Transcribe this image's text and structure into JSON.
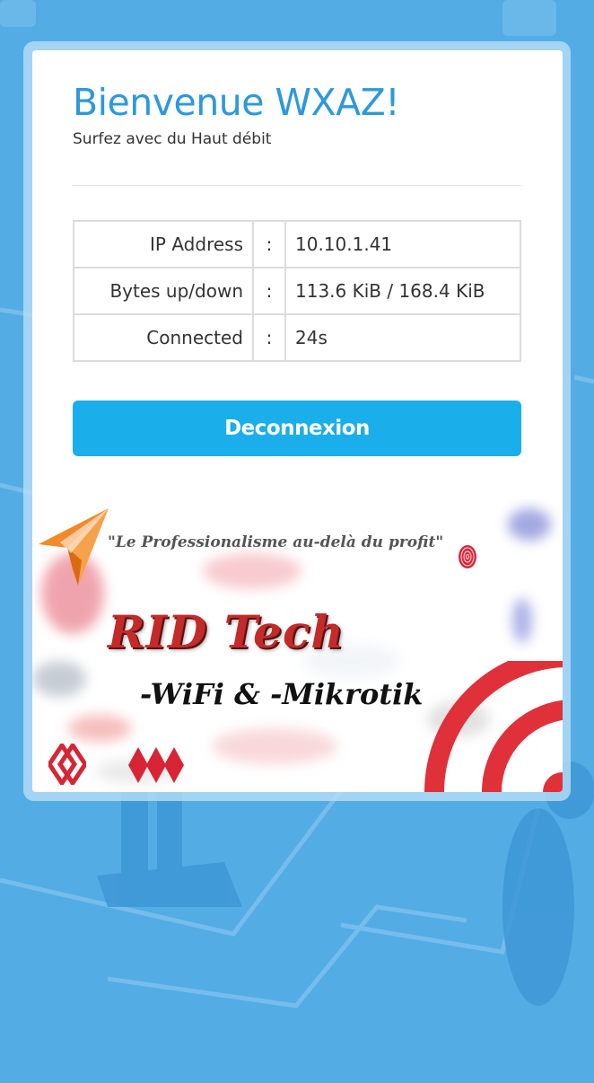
{
  "header": {
    "title": "Bienvenue WXAZ!",
    "subtitle": "Surfez avec du Haut débit"
  },
  "status_table": {
    "rows": [
      {
        "label": "IP Address",
        "separator": ":",
        "value": "10.10.1.41"
      },
      {
        "label": "Bytes up/down",
        "separator": ":",
        "value": "113.6 KiB / 168.4 KiB"
      },
      {
        "label": "Connected",
        "separator": ":",
        "value": "24s"
      }
    ]
  },
  "actions": {
    "logout_label": "Deconnexion"
  },
  "banner": {
    "slogan": "\"Le Professionalisme au-delà du profit\"",
    "brand": "RID Tech",
    "tagline": "-WiFi & -Mikrotik"
  },
  "colors": {
    "accent": "#2d98dd",
    "button": "#1aaeea",
    "page_background": "#4aa6e2",
    "brand_red": "#e0313a",
    "logo_orange": "#f2892a"
  },
  "icons": {
    "logo": "paper-plane-icon",
    "wifi": "wifi-arcs-icon",
    "diamonds_outline": "double-diamond-outline-icon",
    "diamonds_filled": "triple-diamond-icon",
    "fingerprint": "fingerprint-icon"
  }
}
